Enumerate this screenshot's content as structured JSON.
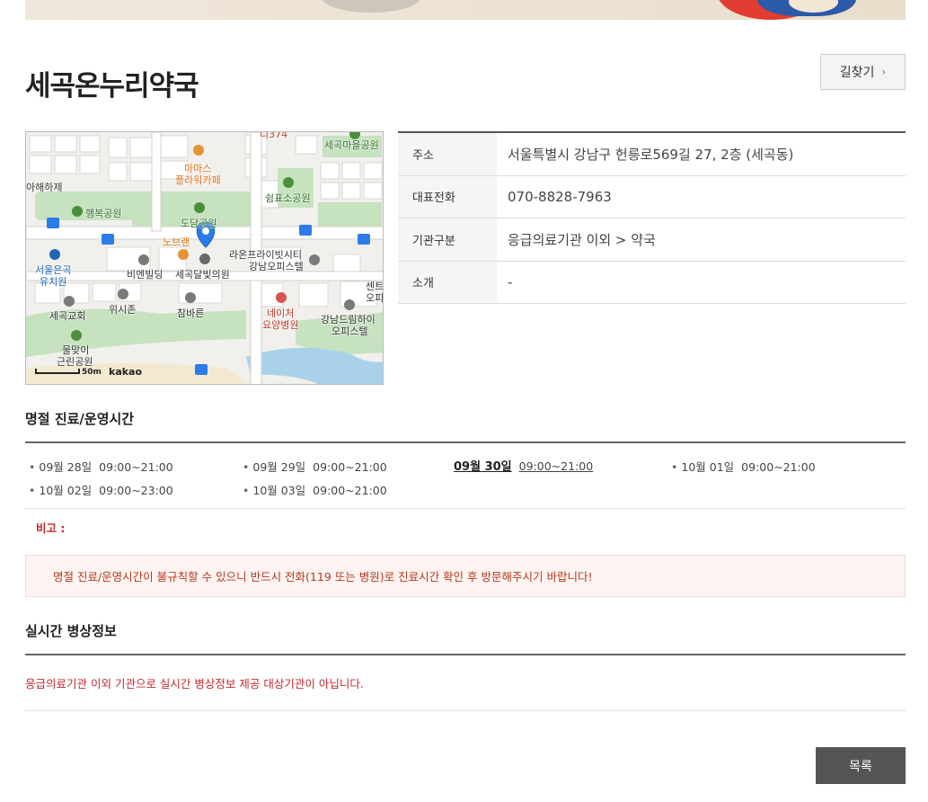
{
  "page": {
    "title": "세곡온누리약국",
    "route_button": {
      "label": "길찾기",
      "icon": "chevron-right-icon"
    }
  },
  "map": {
    "provider": "kakao",
    "scale_label": "50m",
    "labels": {
      "top_partial": "디374",
      "segok_maeul_park": "세곡마을공원",
      "mamas": "마마스",
      "plaza_cafe": "플라워카페",
      "ahae": "아해하제",
      "swimpyo_park": "쉼표소공원",
      "happy_park": "행복공원",
      "dodam_park": "도담공원",
      "nobrand": "노브랜",
      "raon_line1": "라온프라이빗시티",
      "raon_line2": "강남오피스텔",
      "seoul_eunkok_line1": "서울은곡",
      "seoul_eunkok_line2": "유치원",
      "bien_building": "비엔빌딩",
      "segok_clinic": "세곡달빛의원",
      "center_line1": "센트",
      "center_line2": "오피",
      "wishion": "위시존",
      "chambareun": "참바른",
      "nature_line1": "네이처",
      "nature_line2": "요양병원",
      "dream_line1": "강남드림하이",
      "dream_line2": "오피스텔",
      "segok_church": "세곡교회",
      "mulmat_line1": "물맞이",
      "mulmat_line2": "근린공원"
    }
  },
  "info": {
    "rows": [
      {
        "label": "주소",
        "value": "서울특별시 강남구 헌릉로569길 27, 2층 (세곡동)"
      },
      {
        "label": "대표전화",
        "value": "070-8828-7963"
      },
      {
        "label": "기관구분",
        "value": "응급의료기관 이외 > 약국"
      },
      {
        "label": "소개",
        "value": "-"
      }
    ]
  },
  "holiday": {
    "title": "명절 진료/운영시간",
    "items": [
      {
        "date": "09월 28일",
        "time": "09:00~21:00"
      },
      {
        "date": "09월 29일",
        "time": "09:00~21:00"
      },
      {
        "date": "09월 30일",
        "time": "09:00~21:00"
      },
      {
        "date": "10월 01일",
        "time": "09:00~21:00"
      },
      {
        "date": "10월 02일",
        "time": "09:00~23:00"
      },
      {
        "date": "10월 03일",
        "time": "09:00~21:00"
      }
    ],
    "note_label": "비고 :",
    "notice": "명절 진료/운영시간이 불규칙할 수 있으니 반드시 전화(119 또는 병원)로 진료시간 확인 후 방문해주시기 바랍니다!"
  },
  "beds": {
    "title": "실시간 병상정보",
    "message": "응급의료기관 이외 기관으로 실시간 병상정보 제공 대상기관이 아닙니다."
  },
  "footer": {
    "list_button": "목록"
  },
  "colors": {
    "accent_red": "#c0282d",
    "dark_button": "#555555",
    "notice_bg": "#fdf3f1"
  }
}
